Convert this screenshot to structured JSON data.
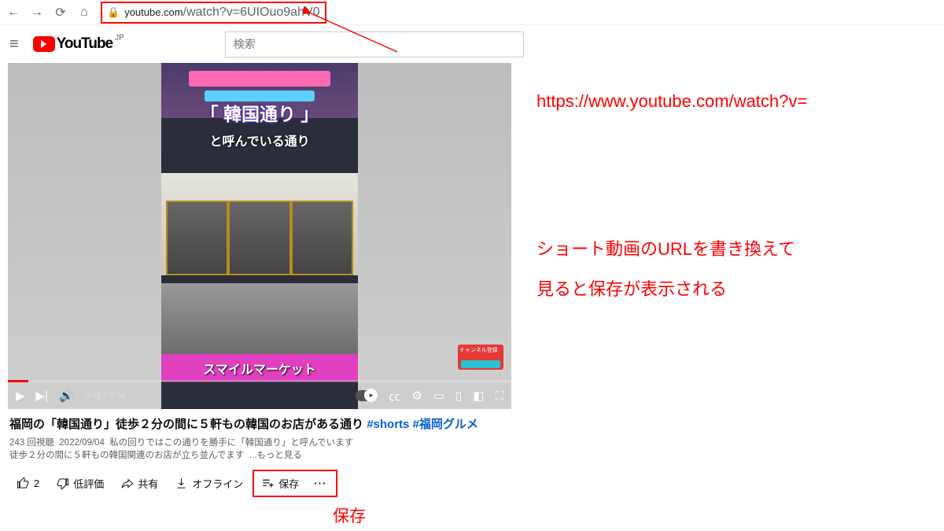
{
  "browser": {
    "url_host": "youtube.com",
    "url_path": "/watch?v=6UIOuo9ahV0"
  },
  "header": {
    "logo_text": "YouTube",
    "region": "JP",
    "search_placeholder": "検索"
  },
  "video": {
    "overlay_title": "「 韓国通り 」",
    "overlay_sub": "と呼んでいる通り",
    "overlay_market": "スマイルマーケット",
    "time_current": "0:01",
    "time_total": "0:54"
  },
  "meta": {
    "title_main": "福岡の「韓国通り」徒歩２分の間に５軒もの韓国のお店がある通り",
    "hashtag1": "#shorts",
    "hashtag2": "#福岡グルメ",
    "views": "243 回視聴",
    "date": "2022/09/04",
    "desc1": "私の回りではこの通りを勝手に「韓国通り」と呼んでいます",
    "desc2": "徒歩２分の間に５軒もの韓国関連のお店が立ち並んでます",
    "more": "...もっと見る"
  },
  "actions": {
    "like_count": "2",
    "dislike": "低評価",
    "share": "共有",
    "offline": "オフライン",
    "save": "保存"
  },
  "annotations": {
    "url_example": "https://www.youtube.com/watch?v=",
    "note_line1": "ショート動画のURLを書き換えて",
    "note_line2": "見ると保存が表示される",
    "save_label": "保存"
  }
}
